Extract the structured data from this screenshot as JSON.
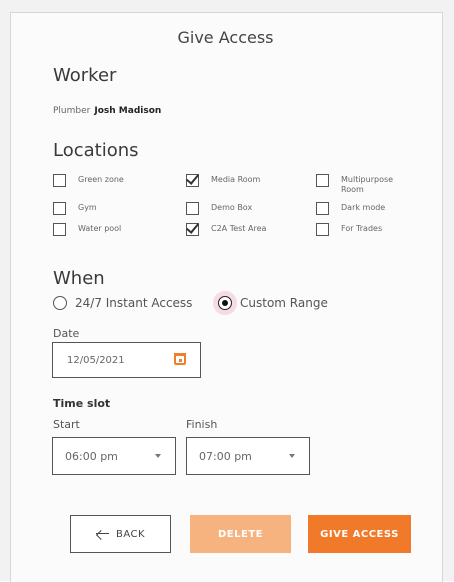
{
  "title": "Give Access",
  "worker": {
    "heading": "Worker",
    "role": "Plumber",
    "name": "Josh Madison"
  },
  "locations": {
    "heading": "Locations",
    "items": [
      {
        "label": "Green zone",
        "checked": false
      },
      {
        "label": "Media Room",
        "checked": true
      },
      {
        "label": "Multipurpose Room",
        "checked": false
      },
      {
        "label": "Gym",
        "checked": false
      },
      {
        "label": "Demo Box",
        "checked": false
      },
      {
        "label": "Dark mode",
        "checked": false
      },
      {
        "label": "Water pool",
        "checked": false
      },
      {
        "label": "C2A Test Area",
        "checked": true
      },
      {
        "label": "For Trades",
        "checked": false
      }
    ]
  },
  "when": {
    "heading": "When",
    "options": [
      {
        "label": "24/7 Instant Access",
        "selected": false
      },
      {
        "label": "Custom Range",
        "selected": true
      }
    ]
  },
  "date": {
    "label": "Date",
    "value": "12/05/2021"
  },
  "timeslot": {
    "label": "Time slot",
    "start_label": "Start",
    "start_value": "06:00 pm",
    "finish_label": "Finish",
    "finish_value": "07:00 pm"
  },
  "buttons": {
    "back": "BACK",
    "delete": "DELETE",
    "give_access": "GIVE ACCESS"
  },
  "colors": {
    "accent": "#f07a2a",
    "accent_disabled": "#f6b27f",
    "selected_ring": "#e878a0"
  }
}
